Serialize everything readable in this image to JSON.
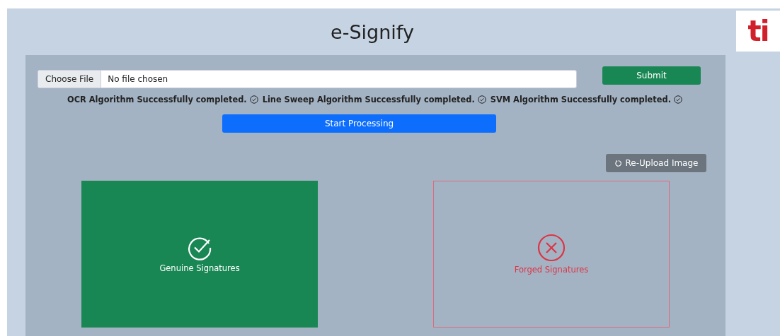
{
  "header": {
    "title": "e-Signify",
    "logo_text": "ti"
  },
  "upload": {
    "button": "Choose File",
    "value": "No file chosen",
    "submit": "Submit"
  },
  "status_messages": [
    {
      "text": "OCR Algorithm Successfully completed.",
      "done": true
    },
    {
      "text": "Line Sweep Algorithm Successfully completed.",
      "done": true
    },
    {
      "text": "SVM Algorithm Successfully completed.",
      "done": true
    }
  ],
  "start_button": "Start Processing",
  "reupload_button": "Re-Upload Image",
  "results": [
    {
      "kind": "genuine",
      "label": "Genuine Signatures",
      "selected": true
    },
    {
      "kind": "forged",
      "label": "Forged Signatures",
      "selected": false
    }
  ]
}
